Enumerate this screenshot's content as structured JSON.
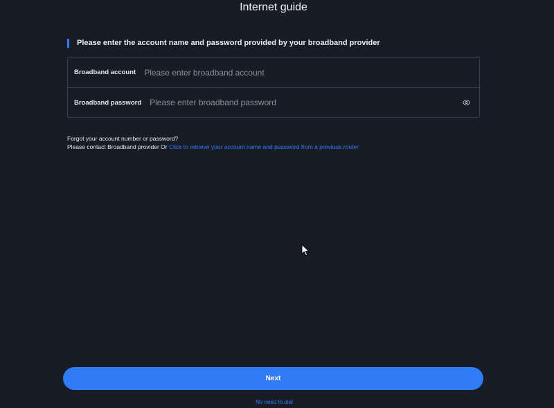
{
  "header": {
    "title": "Internet guide"
  },
  "section": {
    "heading": "Please enter the account name and password provided by your broadband provider"
  },
  "form": {
    "account": {
      "label": "Broadband account",
      "value": "",
      "placeholder": "Please enter broadband account"
    },
    "password": {
      "label": "Broadband password",
      "value": "",
      "placeholder": "Please enter broadband password",
      "toggle_icon": "eye-icon"
    }
  },
  "help": {
    "line1": "Forgot your account number or password?",
    "line2_prefix": "Please contact Broadband provider Or ",
    "line2_link": "Click to retrieve your account name and password from a previous router"
  },
  "actions": {
    "next_label": "Next",
    "skip_label": "No need to dial"
  },
  "colors": {
    "background": "#181c27",
    "accent": "#2f7cf6",
    "border": "#3a3f4c",
    "placeholder": "#8c919c"
  }
}
